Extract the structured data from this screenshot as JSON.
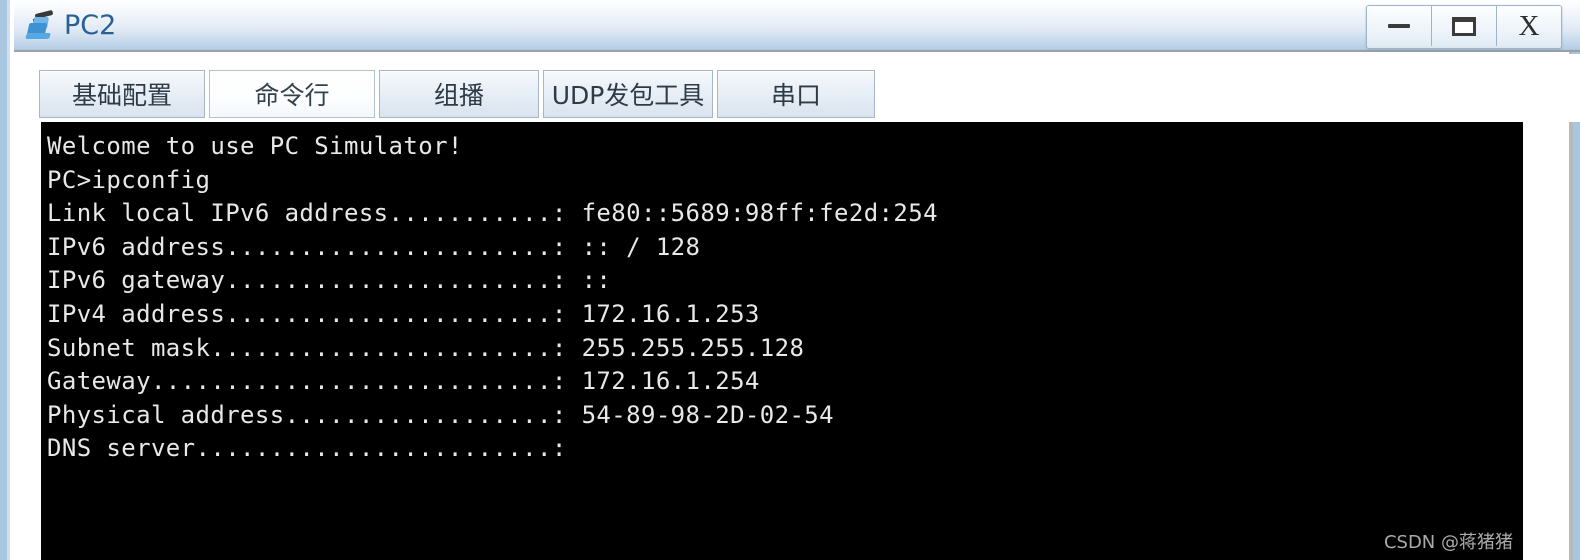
{
  "window": {
    "title": "PC2",
    "icon": "pc-device-icon",
    "controls": [
      {
        "name": "minimize-button",
        "label": "—"
      },
      {
        "name": "maximize-button",
        "label": "❐"
      },
      {
        "name": "close-button",
        "label": "X"
      }
    ]
  },
  "tabs": [
    {
      "label": "基础配置",
      "active": false
    },
    {
      "label": "命令行",
      "active": true
    },
    {
      "label": "组播",
      "active": false
    },
    {
      "label": "UDP发包工具",
      "active": false
    },
    {
      "label": "串口",
      "active": false
    }
  ],
  "terminal": {
    "background": "#000000",
    "foreground": "#e8e8e8",
    "lines": [
      "Welcome to use PC Simulator!",
      "",
      "PC>ipconfig",
      "",
      "Link local IPv6 address...........: fe80::5689:98ff:fe2d:254",
      "IPv6 address......................: :: / 128",
      "IPv6 gateway......................: ::",
      "IPv4 address......................: 172.16.1.253",
      "Subnet mask.......................: 255.255.255.128",
      "Gateway...........................: 172.16.1.254",
      "Physical address..................: 54-89-98-2D-02-54",
      "DNS server........................:"
    ],
    "fields": {
      "link_local_ipv6_address": "fe80::5689:98ff:fe2d:254",
      "ipv6_address": ":: / 128",
      "ipv6_gateway": "::",
      "ipv4_address": "172.16.1.253",
      "subnet_mask": "255.255.255.128",
      "gateway": "172.16.1.254",
      "physical_address": "54-89-98-2D-02-54",
      "dns_server": "",
      "prompt": "PC>",
      "command": "ipconfig",
      "banner": "Welcome to use PC Simulator!"
    }
  },
  "watermark": {
    "text": "CSDN @蒋猪猪"
  },
  "colors": {
    "titlebar_top": "#ffffff",
    "titlebar_bottom": "#b6cfe6",
    "title_text": "#2a5f94",
    "window_border": "#a8c6e0",
    "terminal_bg": "#000000",
    "terminal_fg": "#e8e8e8",
    "tab_border": "#a6b6c6"
  }
}
